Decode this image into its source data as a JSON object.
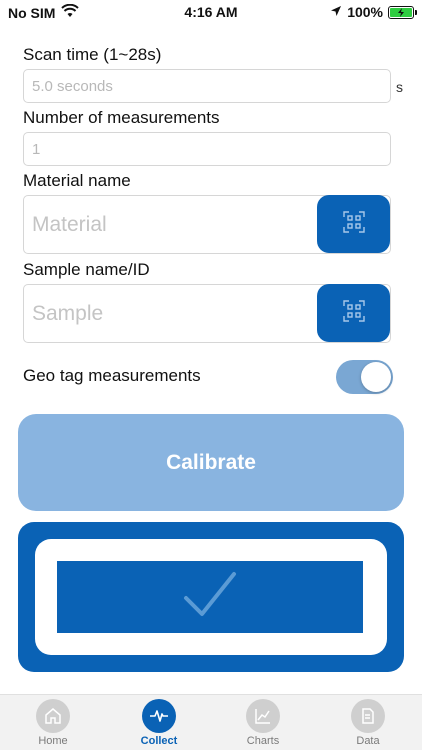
{
  "status_bar": {
    "carrier": "No SIM",
    "time": "4:16 AM",
    "battery": "100%"
  },
  "form": {
    "scan_time": {
      "label": "Scan time (1~28s)",
      "placeholder": "5.0 seconds",
      "unit": "s"
    },
    "num_measurements": {
      "label": "Number of measurements",
      "placeholder": "1"
    },
    "material": {
      "label": "Material name",
      "placeholder": "Material"
    },
    "sample": {
      "label": "Sample name/ID",
      "placeholder": "Sample"
    },
    "geo_tag": {
      "label": "Geo tag measurements",
      "on": true
    }
  },
  "buttons": {
    "calibrate": "Calibrate"
  },
  "tabs": [
    {
      "label": "Home",
      "icon": "home-icon"
    },
    {
      "label": "Collect",
      "icon": "pulse-icon"
    },
    {
      "label": "Charts",
      "icon": "chart-icon"
    },
    {
      "label": "Data",
      "icon": "document-icon"
    }
  ],
  "colors": {
    "primary": "#0a62b5",
    "primary_light": "#89b4e0",
    "toggle_on": "#7aa7d3"
  }
}
